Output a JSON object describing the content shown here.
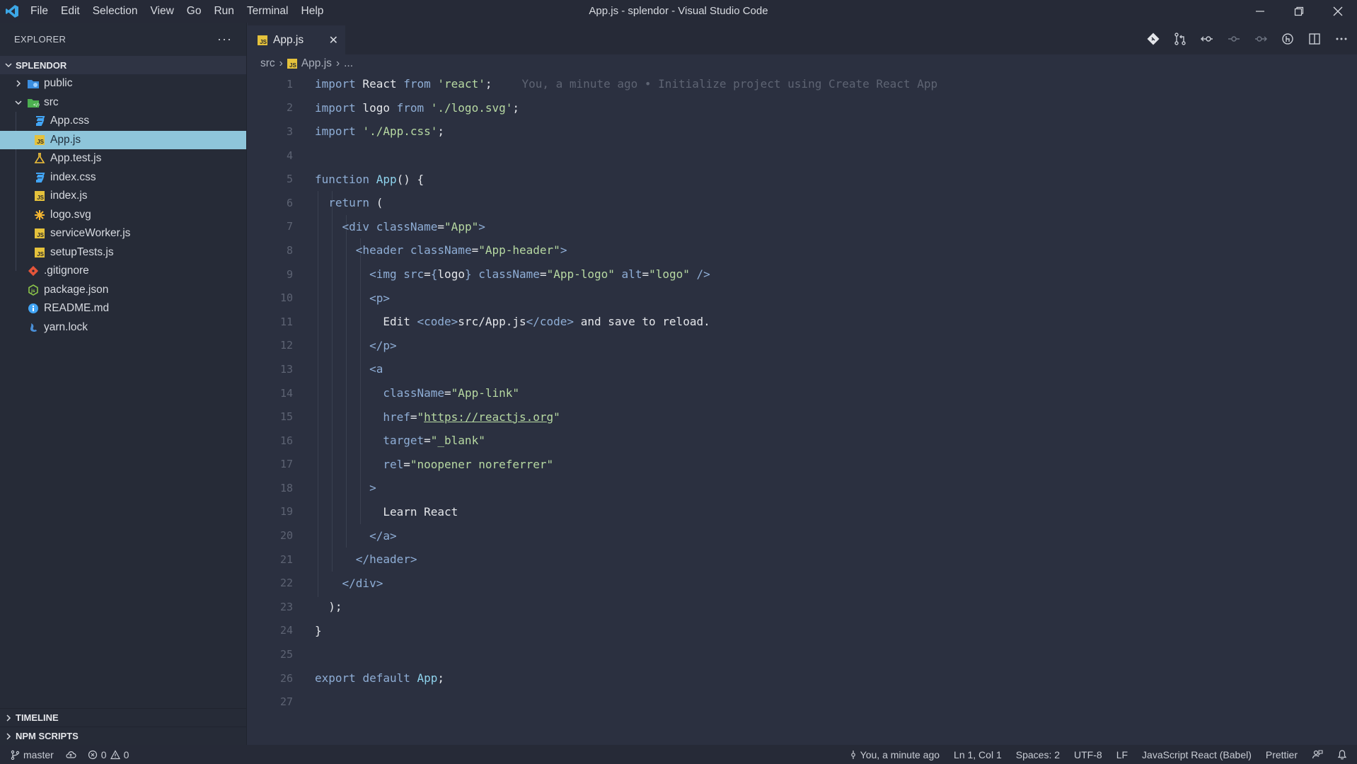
{
  "window": {
    "title": "App.js - splendor - Visual Studio Code",
    "menu": [
      "File",
      "Edit",
      "Selection",
      "View",
      "Go",
      "Run",
      "Terminal",
      "Help"
    ]
  },
  "sidebar": {
    "header": "EXPLORER",
    "more": "···",
    "project": "SPLENDOR",
    "tree": [
      {
        "label": "public",
        "type": "folder",
        "expanded": false,
        "icon": "folder-public-icon"
      },
      {
        "label": "src",
        "type": "folder",
        "expanded": true,
        "icon": "folder-src-icon"
      },
      {
        "label": "App.css",
        "type": "css",
        "icon": "css-file-icon"
      },
      {
        "label": "App.js",
        "type": "js",
        "icon": "js-file-icon",
        "selected": true
      },
      {
        "label": "App.test.js",
        "type": "test",
        "icon": "test-file-icon"
      },
      {
        "label": "index.css",
        "type": "css",
        "icon": "css-file-icon"
      },
      {
        "label": "index.js",
        "type": "js",
        "icon": "js-file-icon"
      },
      {
        "label": "logo.svg",
        "type": "svg",
        "icon": "svg-file-icon"
      },
      {
        "label": "serviceWorker.js",
        "type": "js",
        "icon": "js-file-icon"
      },
      {
        "label": "setupTests.js",
        "type": "js",
        "icon": "js-file-icon"
      },
      {
        "label": ".gitignore",
        "type": "git",
        "icon": "git-file-icon"
      },
      {
        "label": "package.json",
        "type": "npm",
        "icon": "npm-file-icon"
      },
      {
        "label": "README.md",
        "type": "info",
        "icon": "info-file-icon"
      },
      {
        "label": "yarn.lock",
        "type": "yarn",
        "icon": "yarn-file-icon"
      }
    ],
    "timeline": "TIMELINE",
    "npm_scripts": "NPM SCRIPTS"
  },
  "tabs": [
    {
      "label": "App.js",
      "close": "✕"
    }
  ],
  "breadcrumb": {
    "folder": "src",
    "file": "App.js",
    "more": "..."
  },
  "editor": {
    "blame": "You, a minute ago • Initialize project using Create React App",
    "lines": [
      "1",
      "2",
      "3",
      "4",
      "5",
      "6",
      "7",
      "8",
      "9",
      "10",
      "11",
      "12",
      "13",
      "14",
      "15",
      "16",
      "17",
      "18",
      "19",
      "20",
      "21",
      "22",
      "23",
      "24",
      "25",
      "26",
      "27"
    ]
  },
  "statusbar": {
    "branch": "master",
    "errors": "0",
    "warnings": "0",
    "blame": "You, a minute ago",
    "position": "Ln 1, Col 1",
    "spaces": "Spaces: 2",
    "encoding": "UTF-8",
    "eol": "LF",
    "language": "JavaScript React (Babel)",
    "formatter": "Prettier"
  }
}
